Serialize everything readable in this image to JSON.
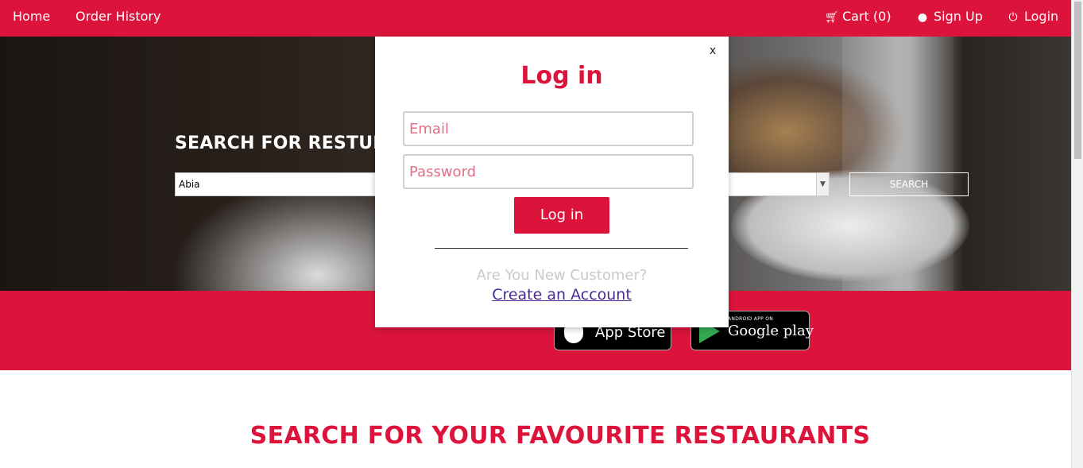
{
  "nav": {
    "home": "Home",
    "order_history": "Order History",
    "cart": "Cart (0)",
    "sign_up": "Sign Up",
    "login": "Login"
  },
  "hero": {
    "title": "SEARCH FOR RESTURAI",
    "state_value": "Abia",
    "search_label": "SEARCH"
  },
  "apps": {
    "app_store": "App Store",
    "google_small": "ANDROID APP ON",
    "google_play": "Google play"
  },
  "section": {
    "heading": "SEARCH FOR YOUR FAVOURITE RESTAURANTS"
  },
  "modal": {
    "close": "x",
    "title": "Log in",
    "email_placeholder": "Email",
    "password_placeholder": "Password",
    "submit": "Log in",
    "new_customer": "Are You New Customer?",
    "create_account": "Create an Account"
  },
  "colors": {
    "brand": "#dc143c",
    "link": "#4b2a93"
  },
  "icons": {
    "cart": "cart-icon",
    "user": "user-icon",
    "power": "power-icon",
    "apple": "apple-icon",
    "play": "google-play-icon"
  }
}
